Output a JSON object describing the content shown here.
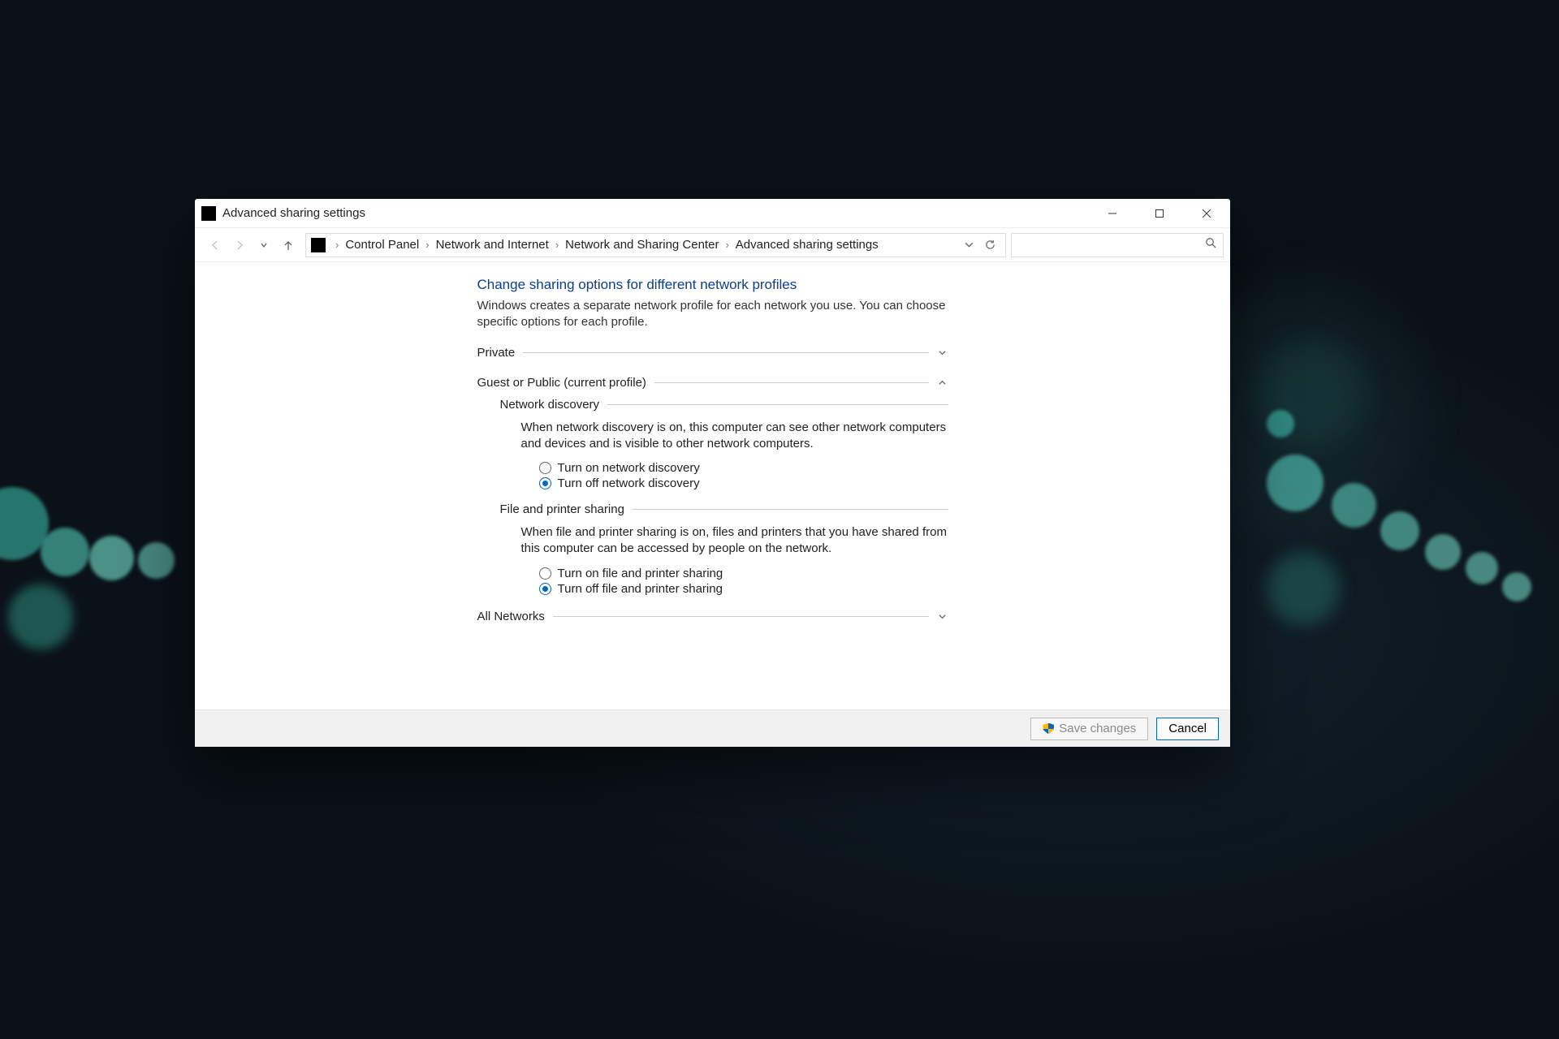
{
  "window": {
    "title": "Advanced sharing settings"
  },
  "breadcrumb": {
    "items": [
      "Control Panel",
      "Network and Internet",
      "Network and Sharing Center",
      "Advanced sharing settings"
    ]
  },
  "page": {
    "heading": "Change sharing options for different network profiles",
    "subtext": "Windows creates a separate network profile for each network you use. You can choose specific options for each profile."
  },
  "sections": {
    "private": {
      "label": "Private",
      "expanded": false
    },
    "guest": {
      "label": "Guest or Public (current profile)",
      "expanded": true
    },
    "all": {
      "label": "All Networks",
      "expanded": false
    }
  },
  "guest": {
    "discovery": {
      "title": "Network discovery",
      "desc": "When network discovery is on, this computer can see other network computers and devices and is visible to other network computers.",
      "options": {
        "on": "Turn on network discovery",
        "off": "Turn off network discovery"
      },
      "selected": "off"
    },
    "fileshare": {
      "title": "File and printer sharing",
      "desc": "When file and printer sharing is on, files and printers that you have shared from this computer can be accessed by people on the network.",
      "options": {
        "on": "Turn on file and printer sharing",
        "off": "Turn off file and printer sharing"
      },
      "selected": "off"
    }
  },
  "footer": {
    "save": "Save changes",
    "cancel": "Cancel"
  }
}
